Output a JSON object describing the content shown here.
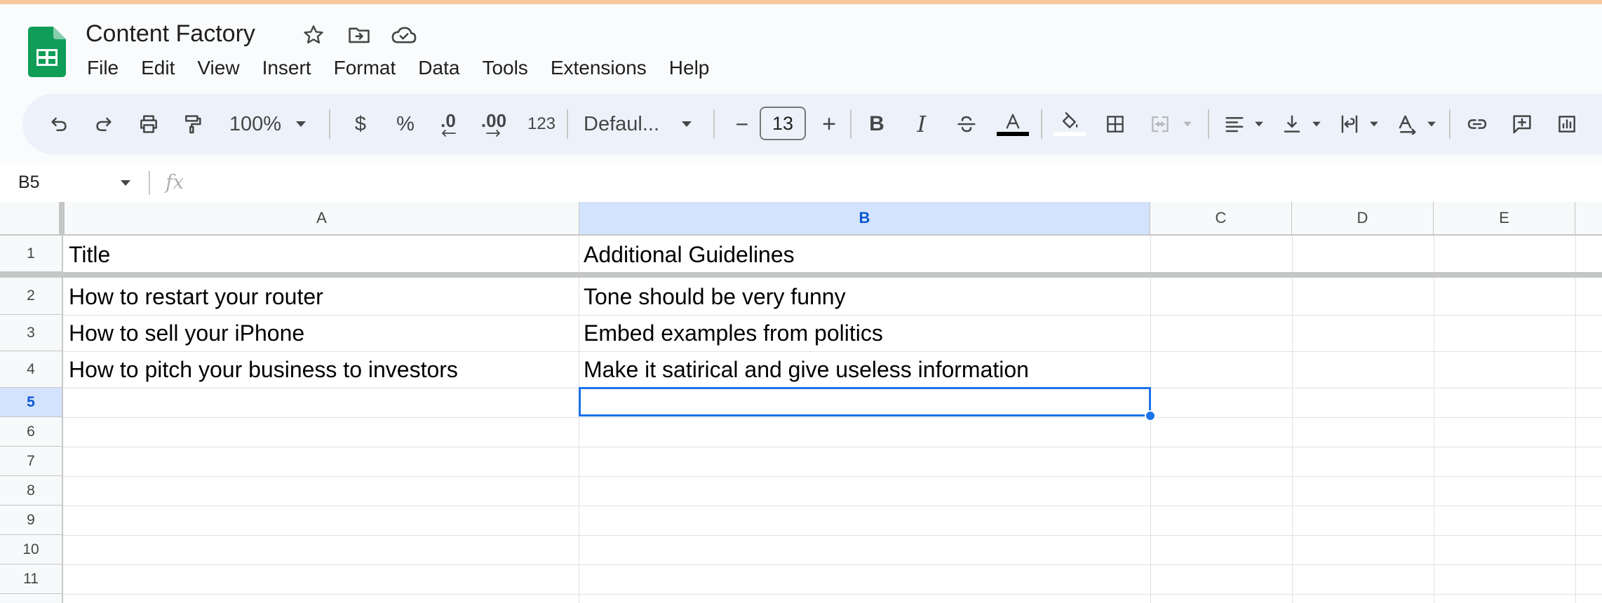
{
  "document": {
    "title": "Content Factory"
  },
  "menu": [
    "File",
    "Edit",
    "View",
    "Insert",
    "Format",
    "Data",
    "Tools",
    "Extensions",
    "Help"
  ],
  "toolbar": {
    "zoom": "100%",
    "currency_symbol": "$",
    "percent_symbol": "%",
    "decrease_decimal": ".0",
    "increase_decimal": ".00",
    "more_formats": "123",
    "font_family": "Defaul...",
    "font_size": "13",
    "minus": "−",
    "plus": "+",
    "bold": "B",
    "italic": "I"
  },
  "formula_bar": {
    "name_box": "B5",
    "fx": "fx",
    "value": ""
  },
  "grid": {
    "columns": [
      "A",
      "B",
      "C",
      "D",
      "E"
    ],
    "rows": [
      "1",
      "2",
      "3",
      "4",
      "5",
      "6",
      "7",
      "8",
      "9",
      "10",
      "11"
    ],
    "selected_cell": "B5",
    "cells": {
      "A1": "Title",
      "B1": "Additional Guidelines",
      "A2": "How to restart your router",
      "B2": "Tone should be very funny",
      "A3": "How to sell your iPhone",
      "B3": "Embed examples from politics",
      "A4": "How to pitch your business to investors",
      "B4": "Make it satirical and give useless information"
    }
  },
  "colors": {
    "accent": "#1a73e8",
    "sheets_green": "#0f9d58",
    "toolbar_bg": "#edf2fa",
    "selected_header_bg": "#d3e3fd"
  }
}
